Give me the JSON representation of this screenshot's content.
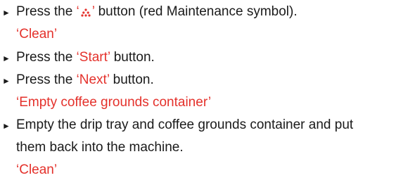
{
  "colors": {
    "text": "#1a1a1a",
    "accent": "#e4312b"
  },
  "steps": [
    {
      "bullet": "►",
      "pre": "Press the ",
      "quote_open": "‘",
      "icon": "maintenance-icon",
      "quote_close": "’",
      "post": " button (red Maintenance symbol).",
      "display": "‘Clean’"
    },
    {
      "bullet": "►",
      "pre": "Press the ",
      "highlight": "‘Start’",
      "post": " button."
    },
    {
      "bullet": "►",
      "pre": "Press the ",
      "highlight": "‘Next’",
      "post": " button.",
      "display": "‘Empty coffee grounds container’"
    },
    {
      "bullet": "►",
      "line1": "Empty the drip tray and coffee grounds container and put",
      "line2": "them back into the machine.",
      "display": "‘Clean’"
    }
  ]
}
